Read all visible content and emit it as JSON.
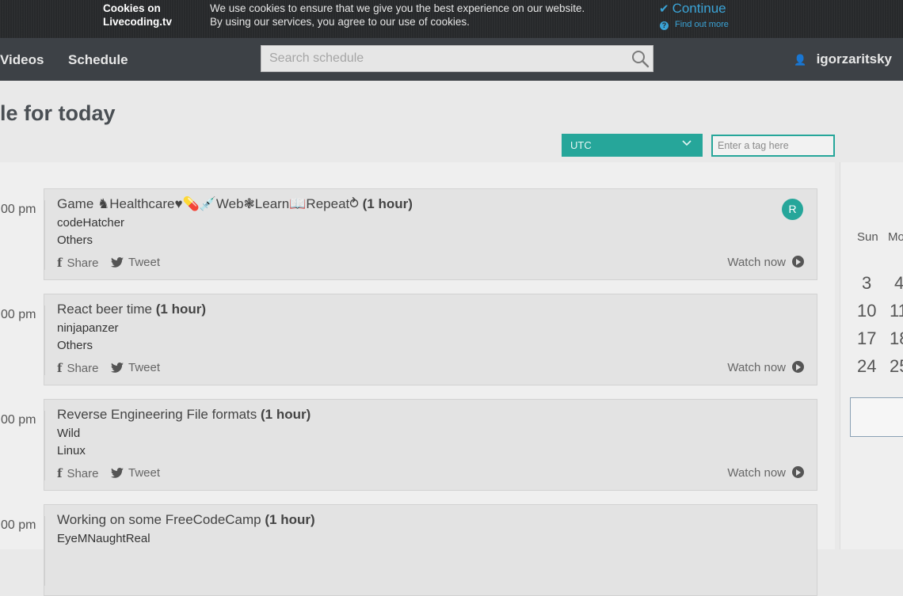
{
  "cookie_bar": {
    "title_line1": "Cookies on",
    "title_line2": "Livecoding.tv",
    "message_line1": "We use cookies to ensure that we give you the best experience on our website.",
    "message_line2": "By using our services, you agree to our use of cookies.",
    "continue_label": "Continue",
    "find_out_more": "Find out more"
  },
  "nav": {
    "links": [
      "Videos",
      "Schedule"
    ],
    "search_placeholder": "Search schedule",
    "username": "igorzaritsky"
  },
  "page": {
    "title": "le for today",
    "timezone": "UTC",
    "tag_placeholder": "Enter a tag here"
  },
  "schedule": [
    {
      "time": "00 pm",
      "title": "Game ♞Healthcare♥💊💉Web❃Learn📖Repeat⥁",
      "duration": "(1 hour)",
      "user": "codeHatcher",
      "category": "Others",
      "avatar": "R"
    },
    {
      "time": "00 pm",
      "title": "React beer time",
      "duration": "(1 hour)",
      "user": "ninjapanzer",
      "category": "Others",
      "avatar": ""
    },
    {
      "time": "00 pm",
      "title": "Reverse Engineering File formats",
      "duration": "(1 hour)",
      "user": "Wild",
      "category": "Linux",
      "avatar": ""
    },
    {
      "time": "00 pm",
      "title": "Working on some FreeCodeCamp",
      "duration": "(1 hour)",
      "user": "EyeMNaughtReal",
      "category": "",
      "avatar": ""
    }
  ],
  "card_actions": {
    "share": "Share",
    "tweet": "Tweet",
    "watch": "Watch now"
  },
  "calendar": {
    "day_headers": [
      "Sun",
      "Mo"
    ],
    "weeks": [
      [
        "3",
        "4"
      ],
      [
        "10",
        "11"
      ],
      [
        "17",
        "18"
      ],
      [
        "24",
        "25"
      ]
    ]
  },
  "colors": {
    "accent": "#26a69a",
    "link": "#3aa3d6",
    "nav_bg": "#3d4146"
  }
}
